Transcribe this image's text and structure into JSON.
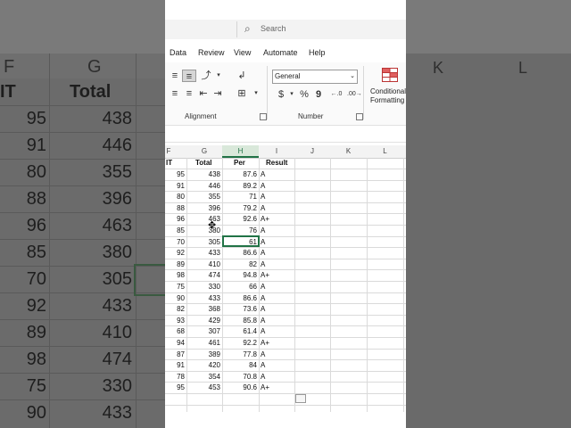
{
  "background": {
    "col_headers": [
      "F",
      "G",
      "K",
      "L"
    ],
    "header_labels": [
      "IT",
      "Total"
    ],
    "rows": [
      {
        "f": "95",
        "g": "438"
      },
      {
        "f": "91",
        "g": "446"
      },
      {
        "f": "80",
        "g": "355"
      },
      {
        "f": "88",
        "g": "396"
      },
      {
        "f": "96",
        "g": "463"
      },
      {
        "f": "85",
        "g": "380"
      },
      {
        "f": "70",
        "g": "305"
      },
      {
        "f": "92",
        "g": "433"
      },
      {
        "f": "89",
        "g": "410"
      },
      {
        "f": "98",
        "g": "474"
      },
      {
        "f": "75",
        "g": "330"
      },
      {
        "f": "90",
        "g": "433"
      }
    ]
  },
  "search": {
    "placeholder": "Search"
  },
  "tabs": [
    "Data",
    "Review",
    "View",
    "Automate",
    "Help"
  ],
  "ribbon": {
    "alignment_label": "Alignment",
    "number_label": "Number",
    "number_format": "General",
    "currency_symbol": "$",
    "percent_symbol": "%",
    "comma_symbol": "9",
    "cond_format_line1": "Conditional",
    "cond_format_line2": "Formatting"
  },
  "sheet": {
    "columns": [
      "F",
      "G",
      "H",
      "I",
      "J",
      "K",
      "L"
    ],
    "active_column": "H",
    "headers": {
      "f": "IT",
      "g": "Total",
      "h": "Per",
      "i": "Result"
    },
    "rows": [
      {
        "f": "95",
        "g": "438",
        "h": "87.6",
        "i": "A"
      },
      {
        "f": "91",
        "g": "446",
        "h": "89.2",
        "i": "A"
      },
      {
        "f": "80",
        "g": "355",
        "h": "71",
        "i": "A"
      },
      {
        "f": "88",
        "g": "396",
        "h": "79.2",
        "i": "A"
      },
      {
        "f": "96",
        "g": "463",
        "h": "92.6",
        "i": "A+"
      },
      {
        "f": "85",
        "g": "380",
        "h": "76",
        "i": "A"
      },
      {
        "f": "70",
        "g": "305",
        "h": "61",
        "i": "A"
      },
      {
        "f": "92",
        "g": "433",
        "h": "86.6",
        "i": "A"
      },
      {
        "f": "89",
        "g": "410",
        "h": "82",
        "i": "A"
      },
      {
        "f": "98",
        "g": "474",
        "h": "94.8",
        "i": "A+"
      },
      {
        "f": "75",
        "g": "330",
        "h": "66",
        "i": "A"
      },
      {
        "f": "90",
        "g": "433",
        "h": "86.6",
        "i": "A"
      },
      {
        "f": "82",
        "g": "368",
        "h": "73.6",
        "i": "A"
      },
      {
        "f": "93",
        "g": "429",
        "h": "85.8",
        "i": "A"
      },
      {
        "f": "68",
        "g": "307",
        "h": "61.4",
        "i": "A"
      },
      {
        "f": "94",
        "g": "461",
        "h": "92.2",
        "i": "A+"
      },
      {
        "f": "87",
        "g": "389",
        "h": "77.8",
        "i": "A"
      },
      {
        "f": "91",
        "g": "420",
        "h": "84",
        "i": "A"
      },
      {
        "f": "78",
        "g": "354",
        "h": "70.8",
        "i": "A"
      },
      {
        "f": "95",
        "g": "453",
        "h": "90.6",
        "i": "A+"
      }
    ]
  },
  "colors": {
    "accent": "#217346",
    "active_col_bg": "#d9e8da"
  }
}
